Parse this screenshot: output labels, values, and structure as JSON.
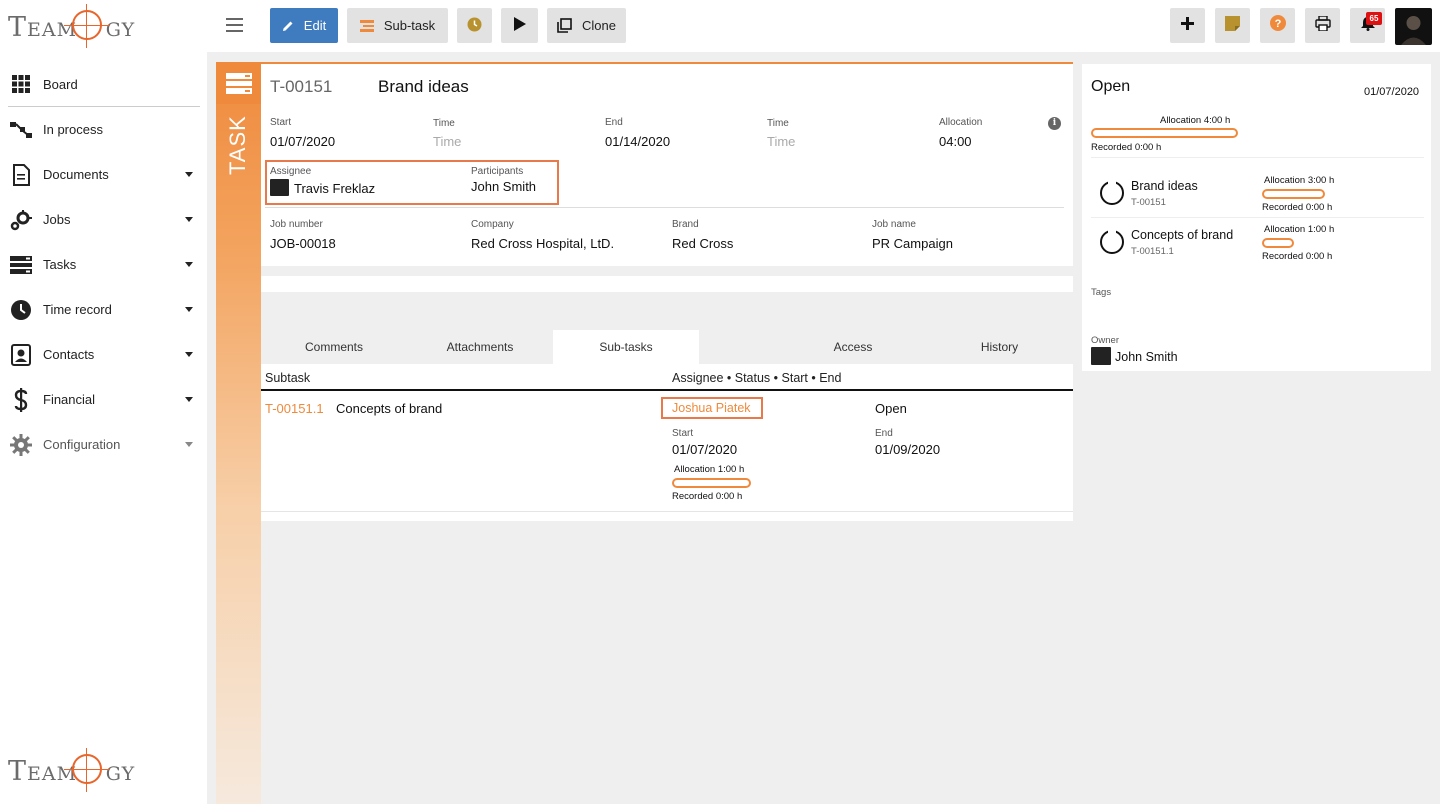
{
  "brand": {
    "logo_text": "TEAMOGY",
    "accent": "#ef8a3d",
    "primary": "#3f7bbf"
  },
  "sidebar": {
    "items": [
      {
        "label": "Board",
        "icon": "grid-icon"
      },
      {
        "label": "In process",
        "icon": "process-icon"
      },
      {
        "label": "Documents",
        "icon": "document-icon"
      },
      {
        "label": "Jobs",
        "icon": "jobs-gear-icon"
      },
      {
        "label": "Tasks",
        "icon": "tasks-icon"
      },
      {
        "label": "Time record",
        "icon": "clock-icon"
      },
      {
        "label": "Contacts",
        "icon": "contacts-icon"
      },
      {
        "label": "Financial",
        "icon": "dollar-icon"
      },
      {
        "label": "Configuration",
        "icon": "gear-icon"
      }
    ]
  },
  "toolbar": {
    "edit_label": "Edit",
    "subtask_label": "Sub-task",
    "clone_label": "Clone",
    "notifications_count": "65"
  },
  "task": {
    "side_label": "TASK",
    "id": "T-00151",
    "name": "Brand ideas",
    "start_label": "Start",
    "start": "01/07/2020",
    "time_label": "Time",
    "time_placeholder": "Time",
    "end_label": "End",
    "end": "01/14/2020",
    "time2_label": "Time",
    "time2_placeholder": "Time",
    "allocation_label": "Allocation",
    "allocation": "04:00",
    "assignee_label": "Assignee",
    "assignee": "Travis Freklaz",
    "participants_label": "Participants",
    "participants": "John Smith",
    "job_number_label": "Job number",
    "job_number": "JOB-00018",
    "company_label": "Company",
    "company": "Red Cross Hospital, LtD.",
    "brand_label": "Brand",
    "brand": "Red Cross",
    "job_name_label": "Job name",
    "job_name": "PR Campaign"
  },
  "tabs": [
    {
      "label": "Comments"
    },
    {
      "label": "Attachments"
    },
    {
      "label": "Sub-tasks",
      "active": true
    },
    {
      "label": ""
    },
    {
      "label": "Access"
    },
    {
      "label": "History"
    }
  ],
  "subtasks": {
    "col_subtask": "Subtask",
    "col_meta": "Assignee • Status • Start • End",
    "rows": [
      {
        "id": "T-00151.1",
        "name": "Concepts of brand",
        "assignee": "Joshua Piatek",
        "status": "Open",
        "start_label": "Start",
        "start": "01/07/2020",
        "end_label": "End",
        "end": "01/09/2020",
        "allocation": "Allocation 1:00 h",
        "recorded": "Recorded 0:00 h",
        "progress": 0
      }
    ]
  },
  "panel": {
    "status": "Open",
    "date": "01/07/2020",
    "allocation": "Allocation 4:00 h",
    "recorded": "Recorded 0:00 h",
    "progress": 0,
    "items": [
      {
        "name": "Brand ideas",
        "id": "T-00151",
        "allocation": "Allocation 3:00 h",
        "recorded": "Recorded 0:00 h",
        "progress": 0
      },
      {
        "name": "Concepts of brand",
        "id": "T-00151.1",
        "allocation": "Allocation 1:00 h",
        "recorded": "Recorded 0:00 h",
        "progress": 0
      }
    ],
    "tags_label": "Tags",
    "owner_label": "Owner",
    "owner": "John Smith"
  }
}
